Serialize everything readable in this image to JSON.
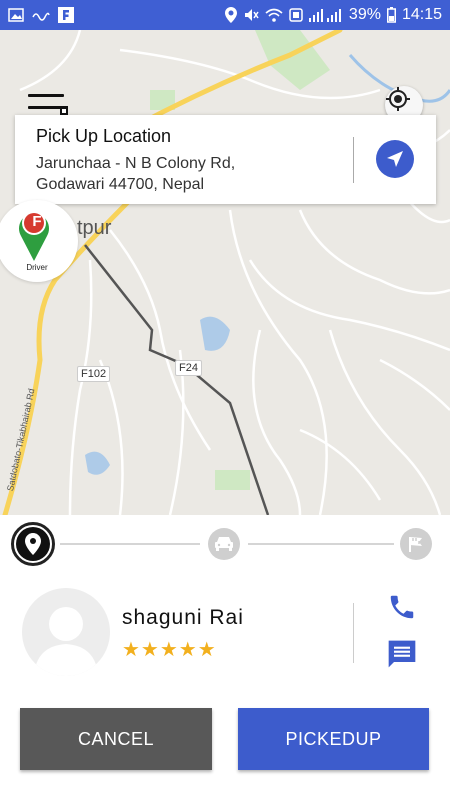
{
  "status_bar": {
    "battery": "39%",
    "time": "14:15"
  },
  "map": {
    "town_label": "tpur",
    "road_labels": [
      "F102",
      "F24"
    ],
    "road_name": "Satdobato-Tikabhairab Rd"
  },
  "pickup": {
    "title": "Pick Up Location",
    "address_line1": "Jarunchaa - N B Colony Rd,",
    "address_line2": "Godawari 44700, Nepal"
  },
  "driver_marker": {
    "badge": "F",
    "label": "Driver"
  },
  "driver": {
    "name": "shaguni Rai",
    "stars": "★★★★★"
  },
  "buttons": {
    "cancel": "CANCEL",
    "pickedup": "PICKEDUP"
  },
  "colors": {
    "primary": "#3d5ccc",
    "status_bar": "#3f5fd3",
    "cancel": "#585858",
    "star": "#f2b01e",
    "marker_green": "#2e9e3f",
    "marker_red": "#d63a2f"
  }
}
